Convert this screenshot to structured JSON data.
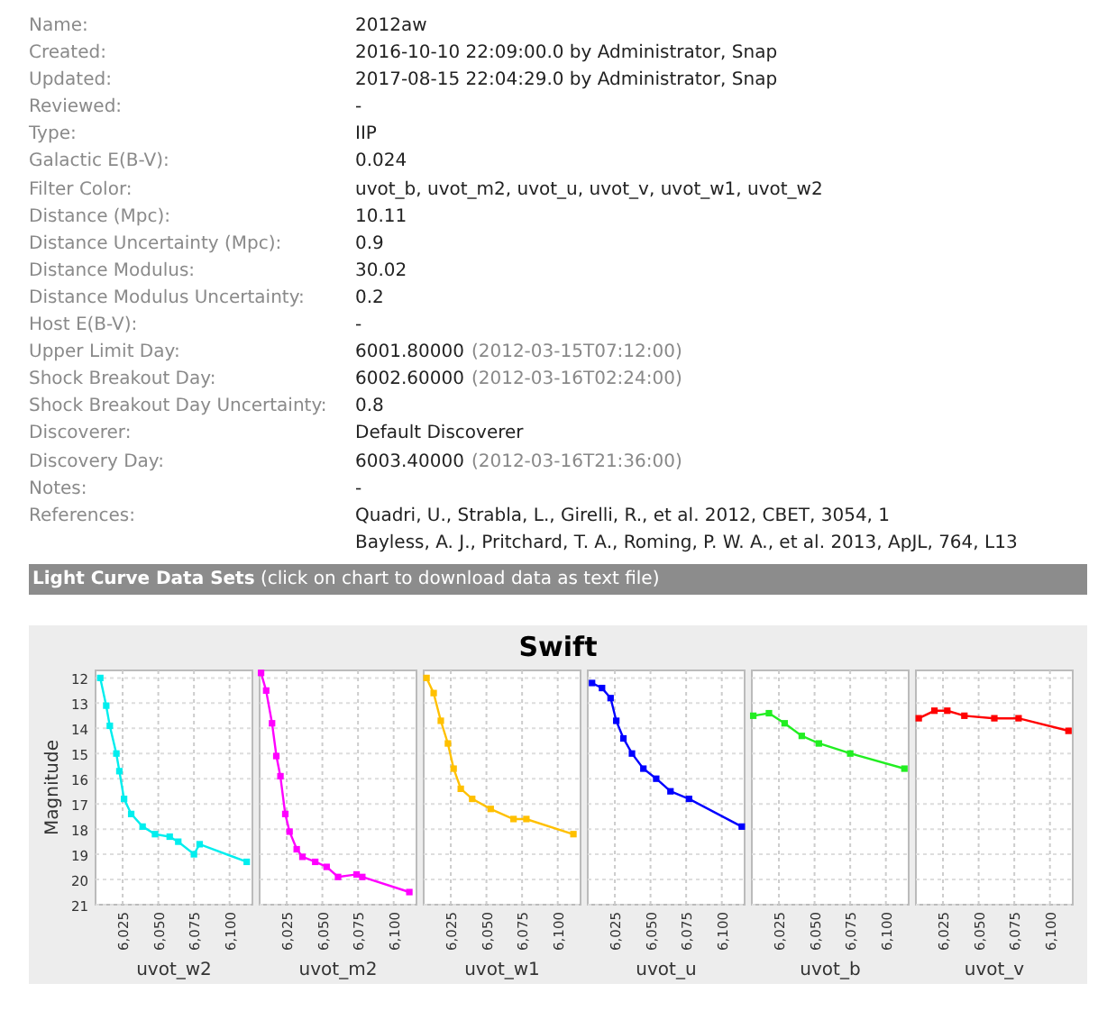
{
  "fields": [
    {
      "label": "Name:",
      "value": "2012aw"
    },
    {
      "label": "Created:",
      "value": "2016-10-10 22:09:00.0 by Administrator, Snap"
    },
    {
      "label": "Updated:",
      "value": "2017-08-15 22:04:29.0 by Administrator, Snap"
    },
    {
      "label": "Reviewed:",
      "value": "-"
    },
    {
      "label": "Type:",
      "value": "IIP"
    },
    {
      "label": "Galactic E(B-V):",
      "value": "0.024"
    },
    {
      "label": "Filter Color:",
      "value": "uvot_b, uvot_m2, uvot_u, uvot_v, uvot_w1, uvot_w2"
    },
    {
      "label": "Distance (Mpc):",
      "value": "10.11"
    },
    {
      "label": "Distance Uncertainty (Mpc):",
      "value": "0.9"
    },
    {
      "label": "Distance Modulus:",
      "value": "30.02"
    },
    {
      "label": "Distance Modulus Uncertainty:",
      "value": "0.2"
    },
    {
      "label": "Host E(B-V):",
      "value": "-"
    },
    {
      "label": "Upper Limit Day:",
      "value": "6001.80000",
      "note": "(2012-03-15T07:12:00)"
    },
    {
      "label": "Shock Breakout Day:",
      "value": "6002.60000",
      "note": "(2012-03-16T02:24:00)"
    },
    {
      "label": "Shock Breakout Day Uncertainty:",
      "value": "0.8"
    },
    {
      "label": "Discoverer:",
      "value": "Default Discoverer"
    },
    {
      "label": "Discovery Day:",
      "value": "6003.40000",
      "note": "(2012-03-16T21:36:00)"
    },
    {
      "label": "Notes:",
      "value": "-"
    },
    {
      "label": "References:",
      "lines": [
        "Quadri, U., Strabla, L., Girelli, R., et al. 2012, CBET, 3054, 1",
        "Bayless, A. J., Pritchard, T. A., Roming, P. W. A., et al. 2013, ApJL, 764, L13"
      ]
    }
  ],
  "section_header": "**Light Curve Data Sets** (click on chart to download data as text file)",
  "chart_title": "Swift",
  "charts": [
    {
      "chart_data": {
        "type": "line",
        "grid": true,
        "ylabel": "Magnitude",
        "x": [
          6009.3,
          6013.5,
          6016,
          6020.6,
          6022.7,
          6026,
          6031,
          6039,
          6047.7,
          6058,
          6064,
          6075,
          6079,
          6112
        ],
        "series": [
          {
            "name": "uvot_w2",
            "color": "#00eeee",
            "marker": "square",
            "values": [
              12.0,
              13.1,
              13.9,
              15.0,
              15.7,
              16.8,
              17.4,
              17.9,
              18.2,
              18.3,
              18.5,
              19.0,
              18.6,
              19.3
            ]
          }
        ],
        "xlim": [
          6006,
          6116
        ],
        "ylim": [
          21,
          11.7
        ],
        "xticks": [
          {
            "value": 6025,
            "label": "6,025"
          },
          {
            "value": 6050,
            "label": "6,050"
          },
          {
            "value": 6075,
            "label": "6,075"
          },
          {
            "value": 6100,
            "label": "6,100"
          }
        ],
        "yticks": [
          12,
          13,
          14,
          15,
          16,
          17,
          18,
          19,
          20,
          21
        ]
      }
    },
    {
      "chart_data": {
        "type": "line",
        "grid": true,
        "x": [
          6007,
          6010.6,
          6014.7,
          6017.7,
          6020.6,
          6024,
          6027,
          6032,
          6036,
          6045,
          6053,
          6061,
          6074,
          6078,
          6111
        ],
        "series": [
          {
            "name": "uvot_m2",
            "color": "#ff00ff",
            "marker": "square",
            "values": [
              11.8,
              12.5,
              13.8,
              15.1,
              15.9,
              17.4,
              18.1,
              18.8,
              19.1,
              19.3,
              19.5,
              19.9,
              19.8,
              19.9,
              20.5
            ]
          }
        ],
        "xlim": [
          6006,
          6116
        ],
        "ylim": [
          21,
          11.7
        ],
        "xticks": [
          {
            "value": 6025,
            "label": "6,025"
          },
          {
            "value": 6050,
            "label": "6,050"
          },
          {
            "value": 6075,
            "label": "6,075"
          },
          {
            "value": 6100,
            "label": "6,100"
          }
        ]
      }
    },
    {
      "chart_data": {
        "type": "line",
        "grid": true,
        "x": [
          6008,
          6013,
          6018,
          6023,
          6027,
          6032,
          6040,
          6053,
          6069,
          6078,
          6111
        ],
        "series": [
          {
            "name": "uvot_w1",
            "color": "#ffc000",
            "marker": "square",
            "values": [
              12.0,
              12.6,
              13.7,
              14.6,
              15.6,
              16.4,
              16.8,
              17.2,
              17.6,
              17.6,
              18.2
            ]
          }
        ],
        "xlim": [
          6006,
          6116
        ],
        "ylim": [
          21,
          11.7
        ],
        "xticks": [
          {
            "value": 6025,
            "label": "6,025"
          },
          {
            "value": 6050,
            "label": "6,050"
          },
          {
            "value": 6075,
            "label": "6,075"
          },
          {
            "value": 6100,
            "label": "6,100"
          }
        ]
      }
    },
    {
      "chart_data": {
        "type": "line",
        "grid": true,
        "x": [
          6009,
          6016,
          6022,
          6026,
          6031,
          6037,
          6045,
          6054,
          6064,
          6077,
          6114
        ],
        "series": [
          {
            "name": "uvot_u",
            "color": "#0000ff",
            "marker": "square",
            "values": [
              12.2,
              12.4,
              12.8,
              13.7,
              14.4,
              15.0,
              15.6,
              16.0,
              16.5,
              16.8,
              17.9
            ]
          }
        ],
        "xlim": [
          6006,
          6116
        ],
        "ylim": [
          21,
          11.7
        ],
        "xticks": [
          {
            "value": 6025,
            "label": "6,025"
          },
          {
            "value": 6050,
            "label": "6,050"
          },
          {
            "value": 6075,
            "label": "6,075"
          },
          {
            "value": 6100,
            "label": "6,100"
          }
        ]
      }
    },
    {
      "chart_data": {
        "type": "line",
        "grid": true,
        "x": [
          6007,
          6018,
          6029,
          6041,
          6053,
          6075,
          6113
        ],
        "series": [
          {
            "name": "uvot_b",
            "color": "#22ee22",
            "marker": "square",
            "values": [
              13.5,
              13.4,
              13.8,
              14.3,
              14.6,
              15.0,
              15.6
            ]
          }
        ],
        "xlim": [
          6006,
          6116
        ],
        "ylim": [
          21,
          11.7
        ],
        "xticks": [
          {
            "value": 6025,
            "label": "6,025"
          },
          {
            "value": 6050,
            "label": "6,050"
          },
          {
            "value": 6075,
            "label": "6,075"
          },
          {
            "value": 6100,
            "label": "6,100"
          }
        ]
      }
    },
    {
      "chart_data": {
        "type": "line",
        "grid": true,
        "x": [
          6008,
          6019,
          6028,
          6040,
          6061,
          6078,
          6113
        ],
        "series": [
          {
            "name": "uvot_v",
            "color": "#ff0000",
            "marker": "square",
            "values": [
              13.6,
              13.3,
              13.3,
              13.5,
              13.6,
              13.6,
              14.1
            ]
          }
        ],
        "xlim": [
          6006,
          6116
        ],
        "ylim": [
          21,
          11.7
        ],
        "xticks": [
          {
            "value": 6025,
            "label": "6,025"
          },
          {
            "value": 6050,
            "label": "6,050"
          },
          {
            "value": 6075,
            "label": "6,075"
          },
          {
            "value": 6100,
            "label": "6,100"
          }
        ]
      }
    }
  ]
}
